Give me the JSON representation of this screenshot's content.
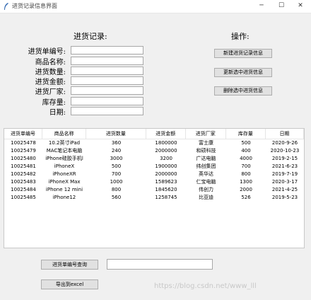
{
  "window": {
    "title": "进货记录信息界面",
    "minimize": "─",
    "maximize": "☐",
    "close": "✕"
  },
  "form": {
    "heading": "进货记录:",
    "labels": [
      "进货单编号:",
      "商品名称:",
      "进货数量:",
      "进货金额:",
      "进货厂家:",
      "库存量:",
      "日期:"
    ]
  },
  "actions": {
    "heading": "操作:",
    "new_label": "新建进货记录信息",
    "update_label": "更新选中进货信息",
    "delete_label": "删除选中进货信息"
  },
  "table": {
    "columns": [
      "进货单编号",
      "商品名称",
      "进货数量",
      "进货金额",
      "进货厂家",
      "库存量",
      "日期"
    ],
    "rows": [
      [
        "10025478",
        "10.2英寸iPad",
        "360",
        "1800000",
        "富士康",
        "500",
        "2020-9-26"
      ],
      [
        "10025479",
        "MAC笔记本电脑",
        "240",
        "2000000",
        "和硕科技",
        "400",
        "2020-10-23"
      ],
      [
        "10025480",
        "iPhone硅胶手机l",
        "3000",
        "3200",
        "广达电脑",
        "4000",
        "2019-2-15"
      ],
      [
        "10025481",
        "iPhoneX",
        "500",
        "1900000",
        "纬创集团",
        "700",
        "2021-6-23"
      ],
      [
        "10025482",
        "iPhoneXR",
        "700",
        "2000000",
        "英华达",
        "800",
        "2019-7-19"
      ],
      [
        "10025483",
        "iPhoneX Max",
        "1000",
        "1589623",
        "仁宝电脑",
        "1300",
        "2020-3-17"
      ],
      [
        "10025484",
        "iPhone 12 mini",
        "800",
        "1845620",
        "伟创力",
        "2000",
        "2021-4-25"
      ],
      [
        "10025485",
        "iPhone12",
        "560",
        "1258745",
        "比亚迪",
        "526",
        "2019-5-23"
      ]
    ]
  },
  "bottom": {
    "query_label": "进货单编号查询",
    "export_label": "导出到excel",
    "watermark": "https://blog.csdn.net/www_lll"
  }
}
